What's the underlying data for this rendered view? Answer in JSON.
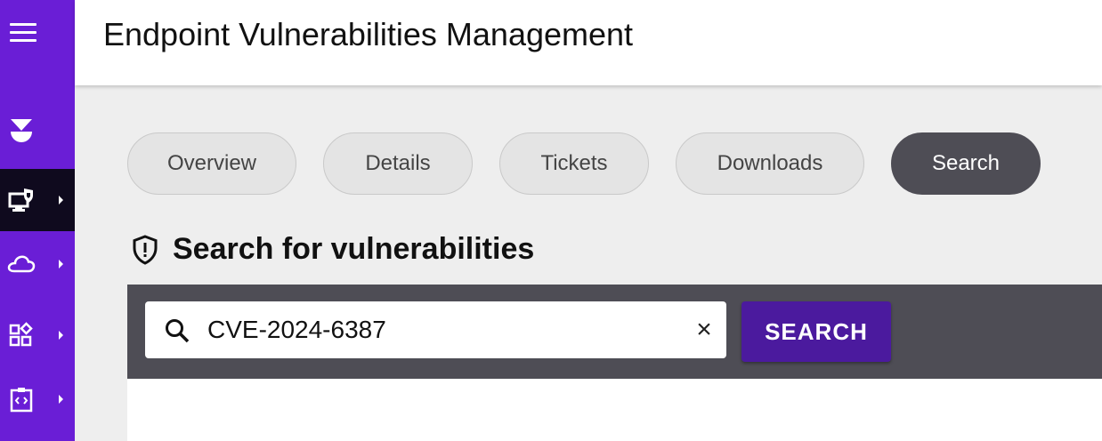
{
  "app": {
    "title": "Endpoint Vulnerabilities Management"
  },
  "sidebar": {
    "items": [
      {
        "icon": "brand-logo-icon",
        "active": false
      },
      {
        "icon": "endpoint-monitor-shield-icon",
        "active": true
      },
      {
        "icon": "cloud-icon",
        "active": false
      },
      {
        "icon": "apps-grid-icon",
        "active": false
      },
      {
        "icon": "code-clipboard-icon",
        "active": false
      }
    ]
  },
  "tabs": [
    {
      "label": "Overview",
      "active": false
    },
    {
      "label": "Details",
      "active": false
    },
    {
      "label": "Tickets",
      "active": false
    },
    {
      "label": "Downloads",
      "active": false
    },
    {
      "label": "Search",
      "active": true
    }
  ],
  "search": {
    "heading": "Search for vulnerabilities",
    "query": "CVE-2024-6387",
    "clear_symbol": "×",
    "button_label": "SEARCH"
  },
  "colors": {
    "sidebar": "#6a1ed6",
    "sidebar_active": "#0f0a1e",
    "panel": "#4e4d55",
    "button": "#4b1a9e",
    "content_bg": "#eeeeee"
  }
}
